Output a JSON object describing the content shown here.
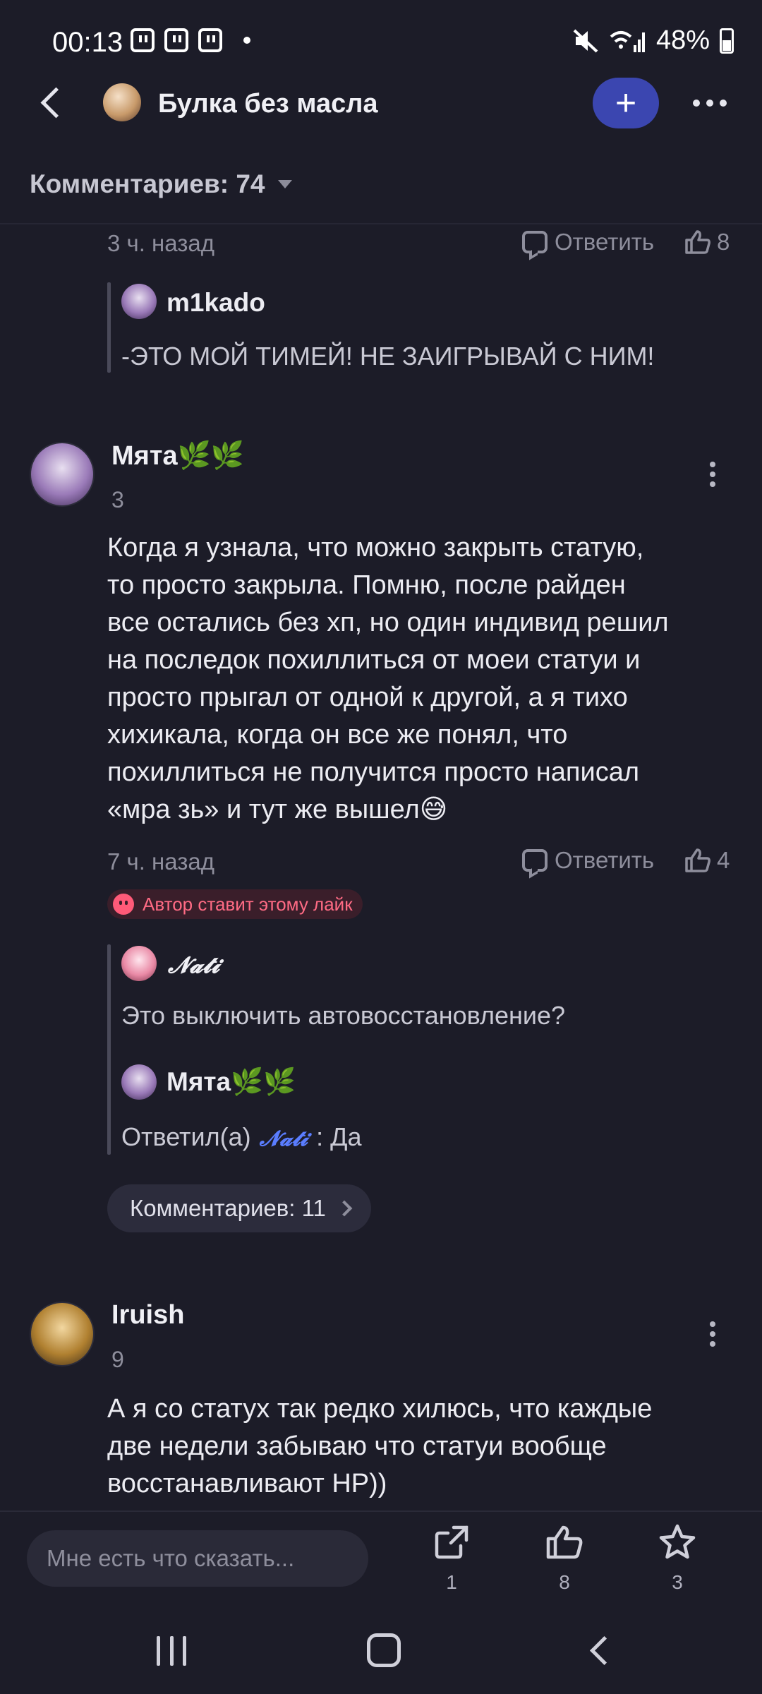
{
  "status_bar": {
    "time": "00:13",
    "battery": "48%"
  },
  "header": {
    "title": "Булка без масла",
    "plus": "+"
  },
  "comments_header": {
    "label": "Комментариев: 74"
  },
  "comment_top": {
    "time": "3 ч. назад",
    "reply_label": "Ответить",
    "likes": "8",
    "quote": {
      "user": "m1kado",
      "text": "-ЭТО МОЙ ТИМЕЙ! НЕ ЗАИГРЫВАЙ С НИМ!"
    }
  },
  "comment_myata": {
    "user": "Мята🌿🌿",
    "level": "3",
    "text_lines": [
      "Когда я узнала, что можно закрыть статую,",
      "то просто закрыла. Помню, после райден",
      "все остались без хп, но один индивид решил",
      "на последок похиллиться от моеи статуи и",
      "просто прыгал от одной к другой, а я тихо",
      "хихикала, когда он все же понял, что",
      "похиллиться не получится просто написал",
      "«мра зь» и тут же вышел😅"
    ],
    "time": "7 ч. назад",
    "reply_label": "Ответить",
    "likes": "4",
    "author_badge": "Автор ставит этому лайк",
    "reply_1": {
      "user": "𝓝𝓪𝓽𝓲",
      "text": "Это выключить автовосстановление?"
    },
    "reply_2": {
      "user": "Мята🌿🌿",
      "prefix": "Ответил(а)",
      "mention": "𝓝𝓪𝓽𝓲",
      "text": ": Да"
    },
    "more_comments": "Комментариев: 11"
  },
  "comment_iruish": {
    "user": "Iruish",
    "level": "9",
    "text_lines": [
      "А я со статух так редко хилюсь, что каждые",
      "две недели забываю что статуи вообще",
      "восстанавливают HP))"
    ]
  },
  "bottom_bar": {
    "input_placeholder": "Мне есть что сказать...",
    "share_count": "1",
    "like_count": "8",
    "star_count": "3"
  }
}
